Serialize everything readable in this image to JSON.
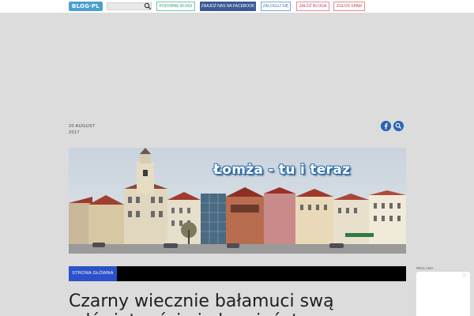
{
  "topbar": {
    "logo_text": "BLOG·PL",
    "search_placeholder": "",
    "buttons": {
      "podobne": "Podobne blogi",
      "facebook": "Znajdź nas na Facebook",
      "zaloguj": "Zaloguj się",
      "zaloz": "Załóż bloga",
      "spam": "Zgłoś spam"
    }
  },
  "post_date": {
    "day_month": "20 AUGUST",
    "year": "2017"
  },
  "header": {
    "title": "Łomża - tu i teraz"
  },
  "nav": {
    "home_label": "STRONA GŁÓWNA"
  },
  "post": {
    "title": "Czarny wiecznie bałamuci swą odświętnością i okrucieństwem"
  },
  "sidebar": {
    "ad_label": "REKLAMA",
    "ad_close": "ⓘ"
  },
  "colors": {
    "accent": "#2b52c9",
    "facebook": "#3b5998",
    "page_bg": "#dcdcdc"
  }
}
